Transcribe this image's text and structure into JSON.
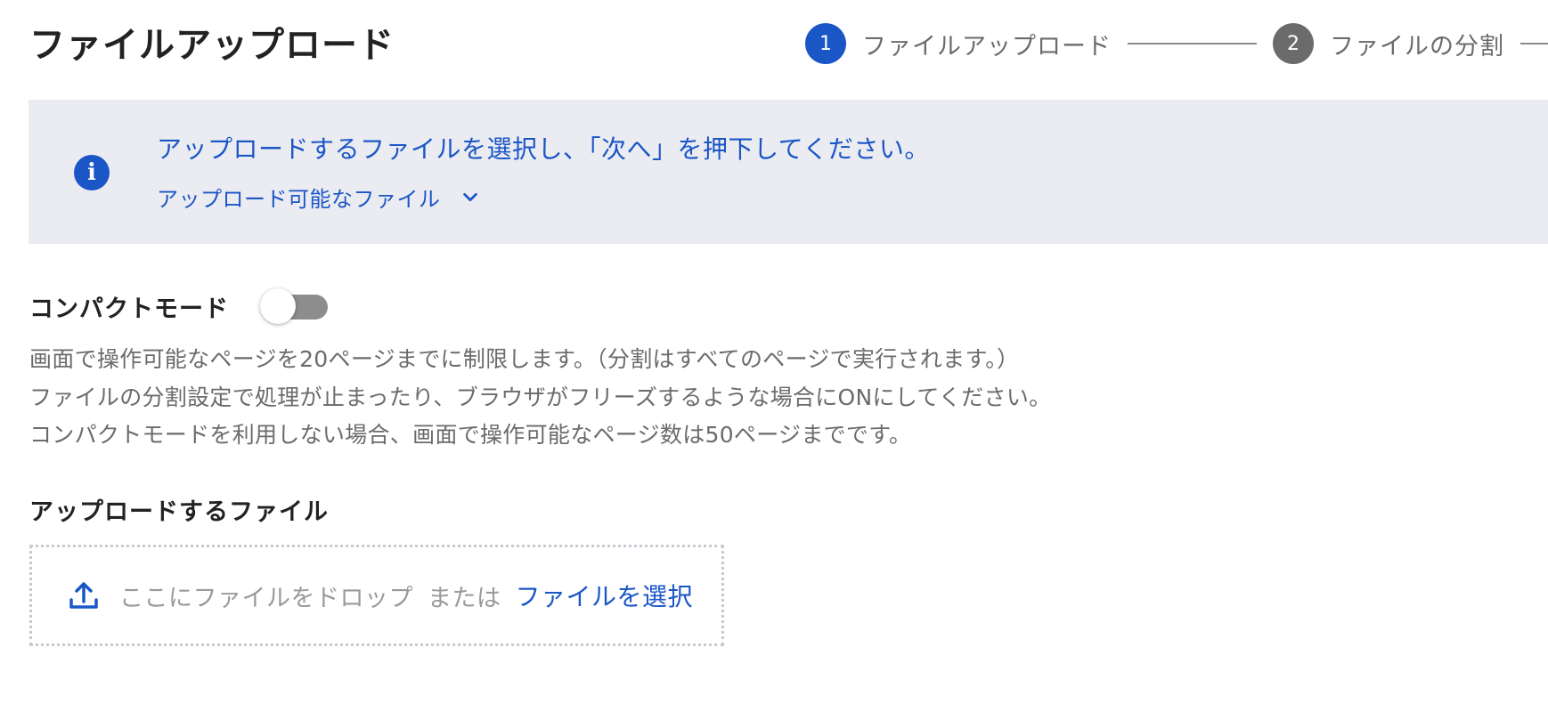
{
  "page": {
    "title": "ファイルアップロード"
  },
  "stepper": {
    "steps": [
      {
        "number": "1",
        "label": "ファイルアップロード",
        "state": "active"
      },
      {
        "number": "2",
        "label": "ファイルの分割",
        "state": "inactive"
      }
    ],
    "colors": {
      "active": "#1b56c7",
      "inactive": "#6b6b6b"
    }
  },
  "info": {
    "icon": "info-icon",
    "message": "アップロードするファイルを選択し、「次へ」を押下してください。",
    "toggle_label": "アップロード可能なファイル",
    "toggle_icon": "chevron-down-icon",
    "background": "#ebecf1",
    "accent": "#1b56c7"
  },
  "compact_mode": {
    "label": "コンパクトモード",
    "enabled": false,
    "description": [
      "画面で操作可能なページを20ページまでに制限します。（分割はすべてのページで実行されます。）",
      "ファイルの分割設定で処理が止まったり、ブラウザがフリーズするような場合にONにしてください。",
      "コンパクトモードを利用しない場合、画面で操作可能なページ数は50ページまでです。"
    ]
  },
  "upload": {
    "section_title": "アップロードするファイル",
    "icon": "upload-icon",
    "drop_text": "ここにファイルをドロップ",
    "or_text": "または",
    "select_label": "ファイルを選択"
  }
}
